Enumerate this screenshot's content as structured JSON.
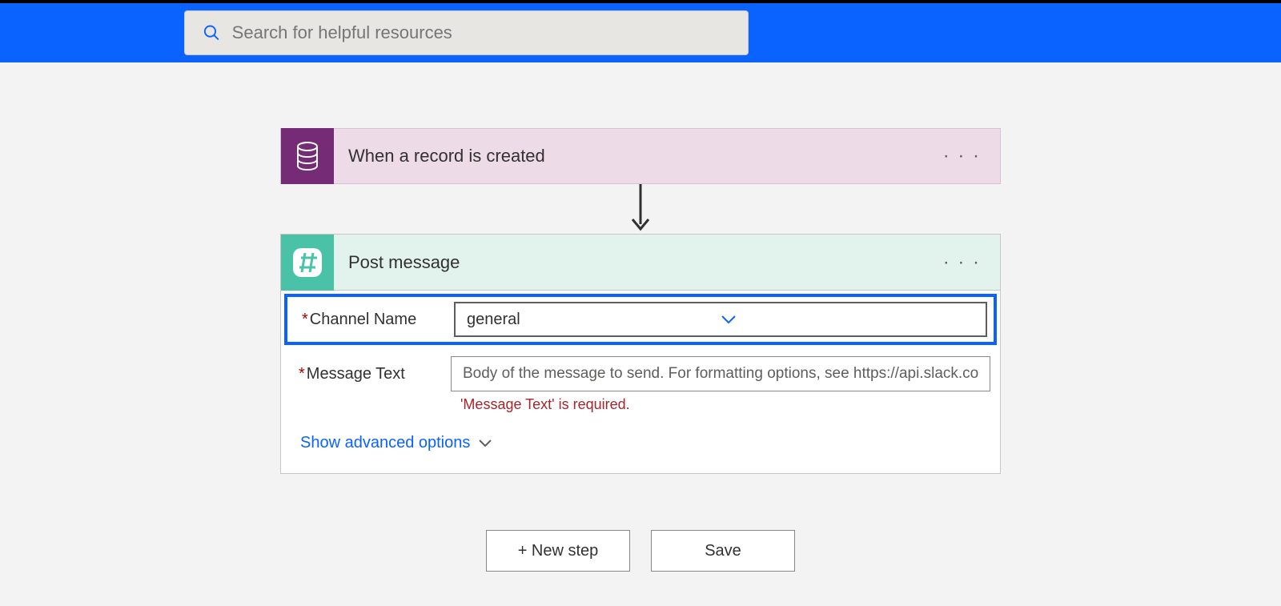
{
  "search": {
    "placeholder": "Search for helpful resources"
  },
  "trigger": {
    "title": "When a record is created",
    "icon": "database-icon"
  },
  "action": {
    "title": "Post message",
    "icon": "hash-icon",
    "fields": {
      "channel": {
        "label": "Channel Name",
        "value": "general"
      },
      "message": {
        "label": "Message Text",
        "placeholder": "Body of the message to send. For formatting options, see https://api.slack.com/",
        "validation": "'Message Text' is required."
      }
    },
    "advanced_label": "Show advanced options"
  },
  "buttons": {
    "new_step": "+ New step",
    "save": "Save"
  }
}
